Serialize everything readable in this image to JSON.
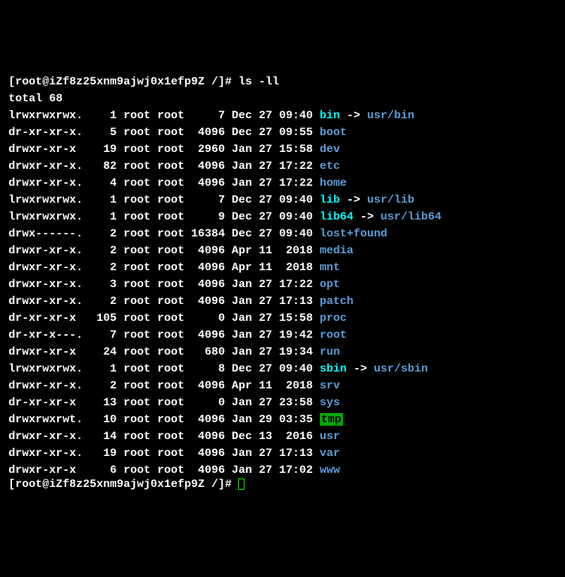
{
  "prompt": {
    "user": "root",
    "host": "iZf8z25xnm9ajwj0x1efp9Z",
    "path": "/",
    "symbol": "#"
  },
  "command": "ls -ll",
  "total_label": "total 68",
  "entries": [
    {
      "perms": "lrwxrwxrwx.",
      "links": "1",
      "owner": "root",
      "group": "root",
      "size": "7",
      "date": "Dec 27 09:40",
      "name": "bin",
      "type": "symlink",
      "target": "usr/bin"
    },
    {
      "perms": "dr-xr-xr-x.",
      "links": "5",
      "owner": "root",
      "group": "root",
      "size": "4096",
      "date": "Dec 27 09:55",
      "name": "boot",
      "type": "dir"
    },
    {
      "perms": "drwxr-xr-x",
      "links": "19",
      "owner": "root",
      "group": "root",
      "size": "2960",
      "date": "Jan 27 15:58",
      "name": "dev",
      "type": "dir"
    },
    {
      "perms": "drwxr-xr-x.",
      "links": "82",
      "owner": "root",
      "group": "root",
      "size": "4096",
      "date": "Jan 27 17:22",
      "name": "etc",
      "type": "dir"
    },
    {
      "perms": "drwxr-xr-x.",
      "links": "4",
      "owner": "root",
      "group": "root",
      "size": "4096",
      "date": "Jan 27 17:22",
      "name": "home",
      "type": "dir"
    },
    {
      "perms": "lrwxrwxrwx.",
      "links": "1",
      "owner": "root",
      "group": "root",
      "size": "7",
      "date": "Dec 27 09:40",
      "name": "lib",
      "type": "symlink",
      "target": "usr/lib"
    },
    {
      "perms": "lrwxrwxrwx.",
      "links": "1",
      "owner": "root",
      "group": "root",
      "size": "9",
      "date": "Dec 27 09:40",
      "name": "lib64",
      "type": "symlink",
      "target": "usr/lib64"
    },
    {
      "perms": "drwx------.",
      "links": "2",
      "owner": "root",
      "group": "root",
      "size": "16384",
      "date": "Dec 27 09:40",
      "name": "lost+found",
      "type": "dir"
    },
    {
      "perms": "drwxr-xr-x.",
      "links": "2",
      "owner": "root",
      "group": "root",
      "size": "4096",
      "date": "Apr 11  2018",
      "name": "media",
      "type": "dir"
    },
    {
      "perms": "drwxr-xr-x.",
      "links": "2",
      "owner": "root",
      "group": "root",
      "size": "4096",
      "date": "Apr 11  2018",
      "name": "mnt",
      "type": "dir"
    },
    {
      "perms": "drwxr-xr-x.",
      "links": "3",
      "owner": "root",
      "group": "root",
      "size": "4096",
      "date": "Jan 27 17:22",
      "name": "opt",
      "type": "dir"
    },
    {
      "perms": "drwxr-xr-x.",
      "links": "2",
      "owner": "root",
      "group": "root",
      "size": "4096",
      "date": "Jan 27 17:13",
      "name": "patch",
      "type": "dir"
    },
    {
      "perms": "dr-xr-xr-x",
      "links": "105",
      "owner": "root",
      "group": "root",
      "size": "0",
      "date": "Jan 27 15:58",
      "name": "proc",
      "type": "dir"
    },
    {
      "perms": "dr-xr-x---.",
      "links": "7",
      "owner": "root",
      "group": "root",
      "size": "4096",
      "date": "Jan 27 19:42",
      "name": "root",
      "type": "dir"
    },
    {
      "perms": "drwxr-xr-x",
      "links": "24",
      "owner": "root",
      "group": "root",
      "size": "680",
      "date": "Jan 27 19:34",
      "name": "run",
      "type": "dir"
    },
    {
      "perms": "lrwxrwxrwx.",
      "links": "1",
      "owner": "root",
      "group": "root",
      "size": "8",
      "date": "Dec 27 09:40",
      "name": "sbin",
      "type": "symlink",
      "target": "usr/sbin"
    },
    {
      "perms": "drwxr-xr-x.",
      "links": "2",
      "owner": "root",
      "group": "root",
      "size": "4096",
      "date": "Apr 11  2018",
      "name": "srv",
      "type": "dir"
    },
    {
      "perms": "dr-xr-xr-x",
      "links": "13",
      "owner": "root",
      "group": "root",
      "size": "0",
      "date": "Jan 27 23:58",
      "name": "sys",
      "type": "dir"
    },
    {
      "perms": "drwxrwxrwt.",
      "links": "10",
      "owner": "root",
      "group": "root",
      "size": "4096",
      "date": "Jan 29 03:35",
      "name": "tmp",
      "type": "sticky"
    },
    {
      "perms": "drwxr-xr-x.",
      "links": "14",
      "owner": "root",
      "group": "root",
      "size": "4096",
      "date": "Dec 13  2016",
      "name": "usr",
      "type": "dir"
    },
    {
      "perms": "drwxr-xr-x.",
      "links": "19",
      "owner": "root",
      "group": "root",
      "size": "4096",
      "date": "Jan 27 17:13",
      "name": "var",
      "type": "dir"
    },
    {
      "perms": "drwxr-xr-x",
      "links": "6",
      "owner": "root",
      "group": "root",
      "size": "4096",
      "date": "Jan 27 17:02",
      "name": "www",
      "type": "dir"
    }
  ]
}
